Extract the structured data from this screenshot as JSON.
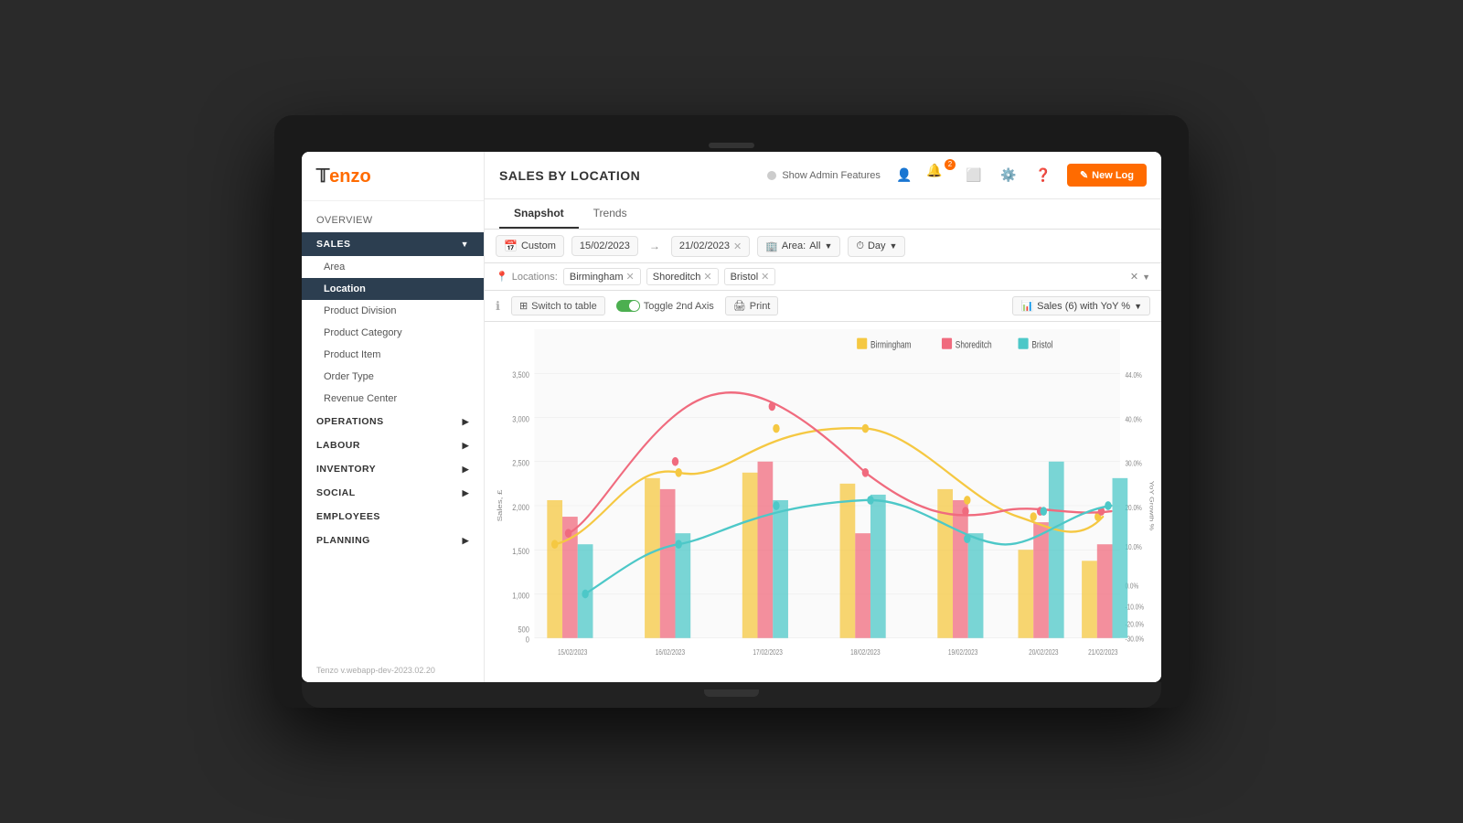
{
  "app": {
    "logo": "Tenzo",
    "page_title": "SALES BY LOCATION",
    "version": "Tenzo v.webapp-dev-2023.02.20"
  },
  "topbar": {
    "admin_toggle": "Show Admin Features",
    "new_log": "New Log"
  },
  "tabs": [
    {
      "id": "snapshot",
      "label": "Snapshot",
      "active": true
    },
    {
      "id": "trends",
      "label": "Trends",
      "active": false
    }
  ],
  "filters": {
    "date_preset": "Custom",
    "date_from": "15/02/2023",
    "date_to": "21/02/2023",
    "area_label": "Area:",
    "area_value": "All",
    "granularity": "Day",
    "locations_label": "Locations:",
    "locations": [
      "Birmingham",
      "Shoreditch",
      "Bristol"
    ]
  },
  "chart_controls": {
    "switch_table": "Switch to table",
    "toggle_axis": "Toggle 2nd Axis",
    "print": "Print",
    "sales_dropdown": "Sales (6) with YoY %"
  },
  "sidebar": {
    "overview": "OVERVIEW",
    "sections": [
      {
        "id": "sales",
        "label": "SALES",
        "expanded": true,
        "items": [
          {
            "id": "area",
            "label": "Area"
          },
          {
            "id": "location",
            "label": "Location",
            "active": true
          },
          {
            "id": "product-division",
            "label": "Product Division"
          },
          {
            "id": "product-category",
            "label": "Product Category"
          },
          {
            "id": "product-item",
            "label": "Product Item"
          },
          {
            "id": "order-type",
            "label": "Order Type"
          },
          {
            "id": "revenue-center",
            "label": "Revenue Center"
          }
        ]
      },
      {
        "id": "operations",
        "label": "OPERATIONS",
        "expanded": false
      },
      {
        "id": "labour",
        "label": "LABOUR",
        "expanded": false
      },
      {
        "id": "inventory",
        "label": "INVENTORY",
        "expanded": false
      },
      {
        "id": "social",
        "label": "SOCIAL",
        "expanded": false
      },
      {
        "id": "employees",
        "label": "EMPLOYEES",
        "expanded": false
      },
      {
        "id": "planning",
        "label": "PLANNING",
        "expanded": false
      }
    ]
  },
  "chart": {
    "y_axis_left_max": "3,500",
    "y_axis_left_min": "0",
    "y_axis_right_max": "44.0%",
    "y_axis_right_min": "-48.4%",
    "x_labels": [
      "15/02/2023",
      "16/02/2023",
      "17/02/2023",
      "18/02/2023",
      "19/02/2023",
      "20/02/2023",
      "21/02/2023"
    ],
    "y_left_label": "Sales, £",
    "y_right_label": "YoY Growth %",
    "legend": [
      {
        "label": "Birmingham",
        "color": "#f5c842"
      },
      {
        "label": "Shoreditch",
        "color": "#f06b7e"
      },
      {
        "label": "Bristol",
        "color": "#4dc8c8"
      }
    ]
  }
}
